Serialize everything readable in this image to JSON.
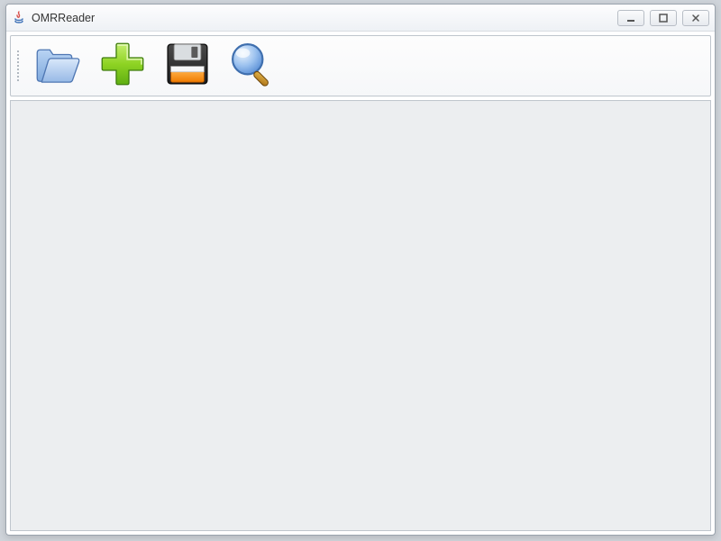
{
  "window": {
    "title": "OMRReader"
  },
  "toolbar": {
    "items": [
      {
        "icon": "folder-open-icon",
        "label": "Open"
      },
      {
        "icon": "add-icon",
        "label": "Add"
      },
      {
        "icon": "save-icon",
        "label": "Save"
      },
      {
        "icon": "search-icon",
        "label": "Search"
      }
    ]
  }
}
